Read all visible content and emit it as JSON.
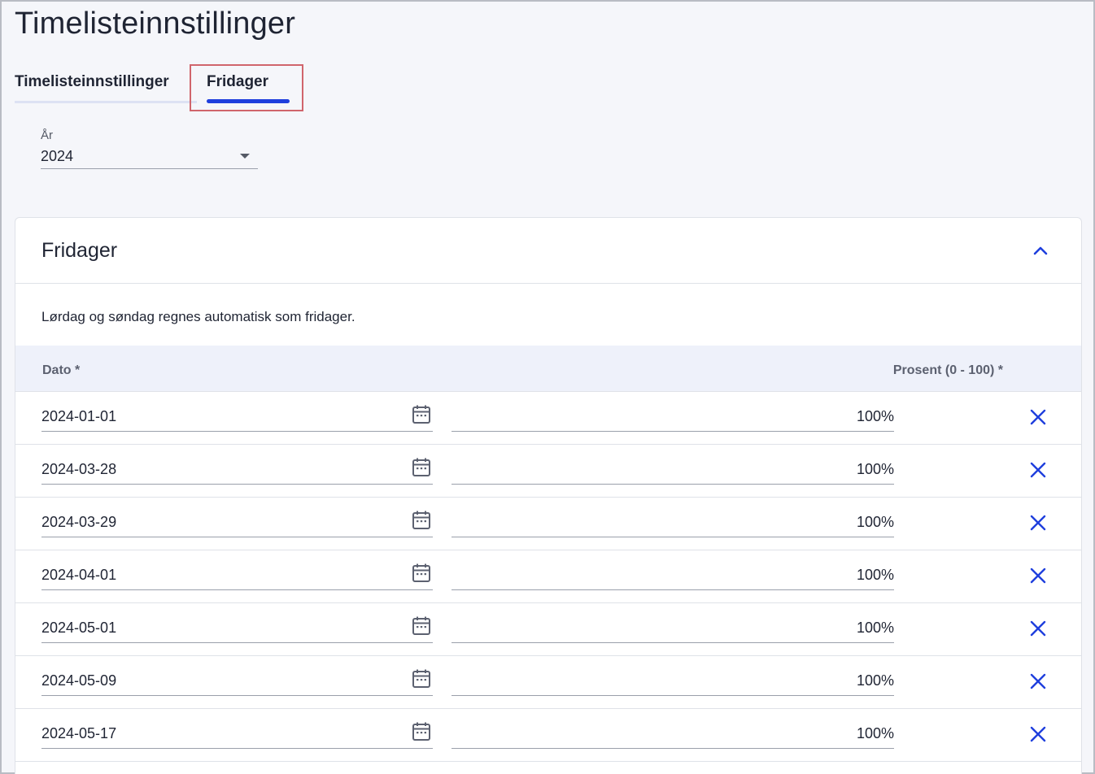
{
  "page": {
    "title": "Timelisteinnstillinger"
  },
  "tabs": [
    {
      "label": "Timelisteinnstillinger",
      "active": false
    },
    {
      "label": "Fridager",
      "active": true
    }
  ],
  "year_select": {
    "label": "År",
    "value": "2024"
  },
  "card": {
    "title": "Fridager",
    "info": "Lørdag og søndag regnes automatisk som fridager.",
    "columns": {
      "date": "Dato *",
      "percent": "Prosent (0 - 100) *"
    },
    "rows": [
      {
        "date": "2024-01-01",
        "percent": "100%"
      },
      {
        "date": "2024-03-28",
        "percent": "100%"
      },
      {
        "date": "2024-03-29",
        "percent": "100%"
      },
      {
        "date": "2024-04-01",
        "percent": "100%"
      },
      {
        "date": "2024-05-01",
        "percent": "100%"
      },
      {
        "date": "2024-05-09",
        "percent": "100%"
      },
      {
        "date": "2024-05-17",
        "percent": "100%"
      }
    ]
  },
  "icons": {
    "calendar": "calendar-icon",
    "delete": "close-icon",
    "collapse": "chevron-up-icon",
    "dropdown": "caret-down-icon"
  },
  "colors": {
    "accent": "#1f3fdd",
    "highlight": "#d0656c"
  }
}
